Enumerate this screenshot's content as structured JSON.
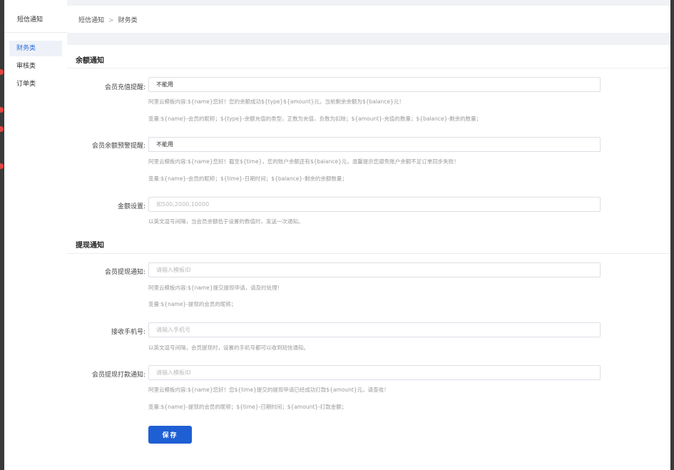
{
  "sidebar": {
    "title": "短信通知",
    "items": [
      {
        "label": "财务类",
        "active": true
      },
      {
        "label": "审核类",
        "active": false
      },
      {
        "label": "订单类",
        "active": false
      }
    ]
  },
  "breadcrumb": {
    "root": "短信通知",
    "separator": ">",
    "current": "财务类"
  },
  "balance_section": {
    "title": "余额通知",
    "recharge": {
      "label": "会员充值提醒:",
      "value": "不能用",
      "hint1": "阿里云模板内容:${name}您好！您的余额成功${type}${amount}元，当前剩余余额为${balance}元！",
      "hint2": "变量:${name}-会员的昵称；${type}-余额充值的类型，正数为充值，负数为扣除；${amount}-充值的数量；${balance}-剩余的数量；"
    },
    "warning": {
      "label": "会员余额预警提醒:",
      "value": "不能用",
      "hint1": "阿里云模板内容:${name}您好！截至${time}，您的账户余额还有${balance}元，温馨提示您避免账户余额不足订单同步失败！",
      "hint2": "变量:${name}-会员的昵称；${time}-日期时间；${balance}-剩余的余额数量；"
    },
    "amount": {
      "label": "金额设置:",
      "placeholder": "如500,2000,10000",
      "hint": "以英文逗号间隔，当会员余额低于设置的数值时，发送一次通知。"
    }
  },
  "withdraw_section": {
    "title": "提现通知",
    "withdraw_notice": {
      "label": "会员提现通知:",
      "placeholder": "请输入模板ID",
      "hint1": "阿里云模板内容:${name}提交提现申请，请及时处理！",
      "hint2": "变量:${name}-提现的会员的昵称；"
    },
    "phone": {
      "label": "接收手机号:",
      "placeholder": "请输入手机号",
      "hint": "以英文逗号间隔，会员提现时，设置的手机号都可以收到短信通知。"
    },
    "payout": {
      "label": "会员提现打款通知:",
      "placeholder": "请输入模板ID",
      "hint1": "阿里云模板内容:${name}您好！您${time}提交的提现申请已经成功打款${amount}元，请查收！",
      "hint2": "变量:${name}-提现的会员的昵称；${time}-日期时间；${amount}-打款金额；"
    }
  },
  "save_label": "保存",
  "colors": {
    "accent": "#1f5fd4",
    "active_nav_bg": "#eef2f8",
    "page_bg": "#f0f2f5"
  }
}
